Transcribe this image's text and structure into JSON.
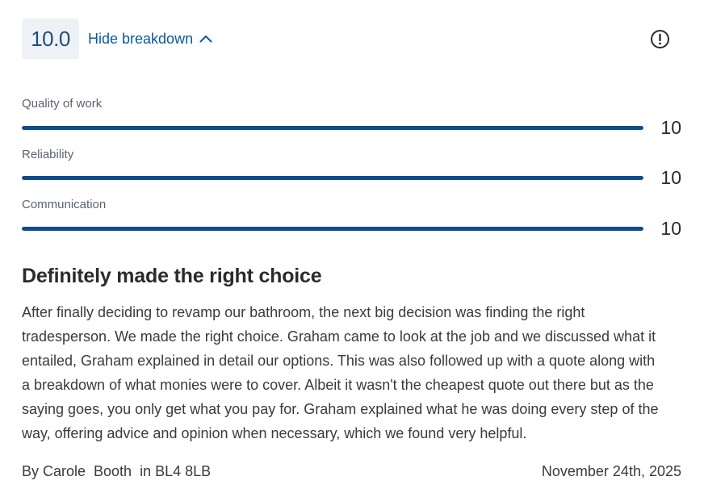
{
  "rating": {
    "overall": "10.0",
    "toggle_label": "Hide breakdown",
    "info_icon": "exclamation-circle-icon"
  },
  "breakdown": [
    {
      "label": "Quality of work",
      "value": "10",
      "fraction": 1.0
    },
    {
      "label": "Reliability",
      "value": "10",
      "fraction": 1.0
    },
    {
      "label": "Communication",
      "value": "10",
      "fraction": 1.0
    }
  ],
  "review": {
    "title": "Definitely made the right choice",
    "lines": [
      "After finally deciding to revamp our bathroom, the next big decision was finding the right",
      "tradesperson. We made the right choice. Graham came to look at the job and we discussed what it",
      "entailed, Graham explained in detail our options. This was also followed up with a quote along with",
      "a breakdown of what monies were to cover. Albeit it wasn't the cheapest quote out there but as the",
      "saying goes, you only get what you pay for.  Graham explained what he was doing every step of the",
      "way, offering advice and opinion when necessary, which we found very helpful."
    ],
    "author_line": "By Carole  Booth  in BL4 8LB",
    "date": "November 24th, 2025"
  },
  "colors": {
    "accent": "#0b4d8c",
    "link": "#0a5a9c",
    "badge_bg": "#eef2f6"
  }
}
